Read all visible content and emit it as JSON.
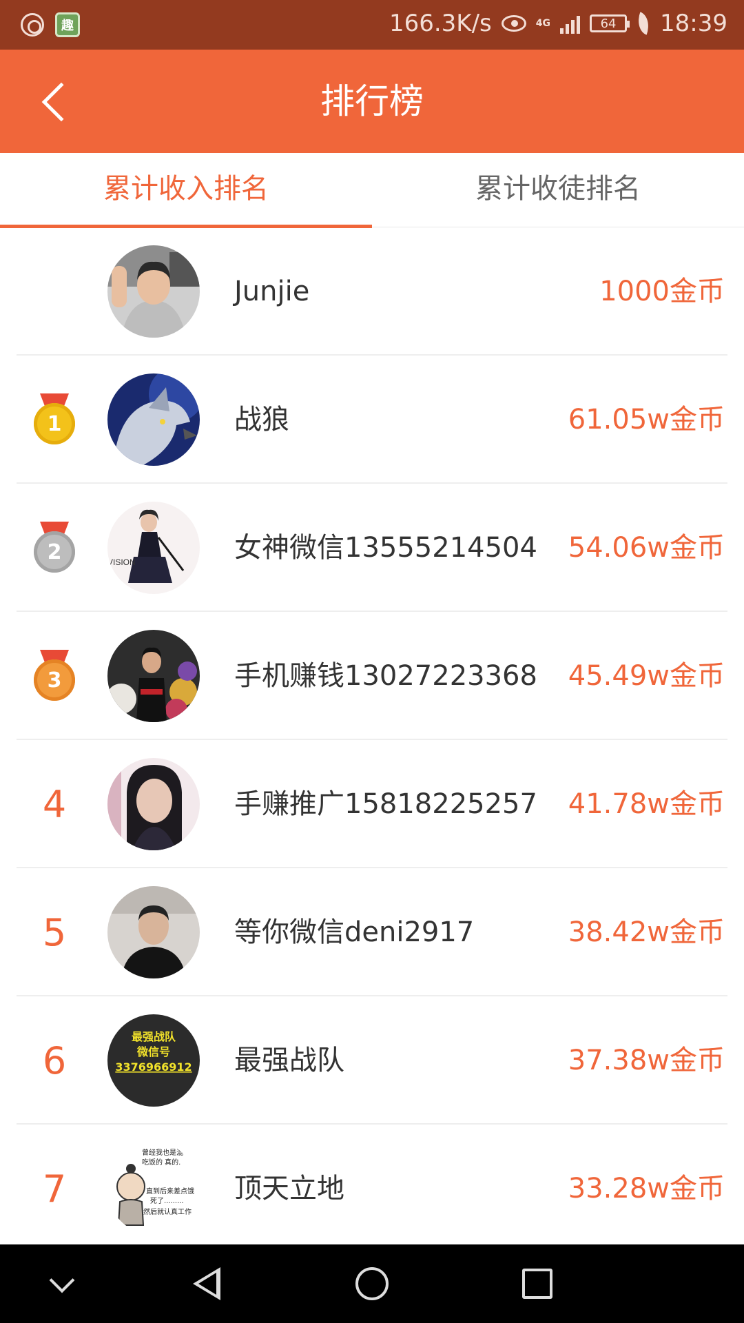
{
  "status_bar": {
    "app2_label": "趣",
    "speed": "166.3K/s",
    "network": "4G",
    "battery": "64",
    "time": "18:39"
  },
  "header": {
    "title": "排行榜"
  },
  "tabs": [
    {
      "label": "累计收入排名",
      "active": true
    },
    {
      "label": "累计收徒排名",
      "active": false
    }
  ],
  "ranking": [
    {
      "rank": "",
      "name": "Junjie",
      "amount": "1000金币"
    },
    {
      "rank": "1",
      "name": "战狼",
      "amount": "61.05w金币"
    },
    {
      "rank": "2",
      "name": "女神微信13555214504",
      "amount": "54.06w金币"
    },
    {
      "rank": "3",
      "name": "手机赚钱13027223368",
      "amount": "45.49w金币"
    },
    {
      "rank": "4",
      "name": "手赚推广15818225257",
      "amount": "41.78w金币"
    },
    {
      "rank": "5",
      "name": "等你微信deni2917",
      "amount": "38.42w金币"
    },
    {
      "rank": "6",
      "name": "最强战队",
      "amount": "37.38w金币"
    },
    {
      "rank": "7",
      "name": "顶天立地",
      "amount": "33.28w金币"
    }
  ],
  "avatar_text": {
    "team_line1": "最强战队",
    "team_line2": "微信号",
    "team_line3": "3376966912",
    "vision": "VISION",
    "meme_line1": "曾经我也是混",
    "meme_line2": "吃饭的   真的.",
    "meme_line3": "直到后来差点饿",
    "meme_line4": "死了.........",
    "meme_line5": "然后就认真工作"
  },
  "colors": {
    "accent": "#f0663a",
    "status_bar": "#933a1f"
  }
}
